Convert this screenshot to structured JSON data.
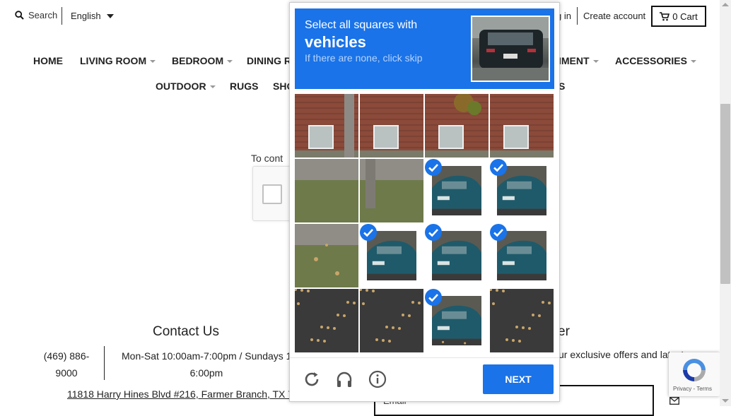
{
  "header": {
    "search_label": "Search",
    "language": "English",
    "login_partial": "g in",
    "create_account": "Create account",
    "cart_label": "0 Cart"
  },
  "nav": {
    "row1": [
      "HOME",
      "LIVING ROOM",
      "BEDROOM",
      "DINING R",
      "IMENT",
      "ACCESSORIES"
    ],
    "row2": [
      "OUTDOOR",
      "RUGS",
      "SHO",
      "S"
    ]
  },
  "page": {
    "partial_prompt": "To cont",
    "contact_title": "Contact Us",
    "phone": "(469) 886-9000",
    "hours": "Mon-Sat 10:00am-7:00pm / Sundays 1 6:00pm",
    "hours_line1": "Mon-Sat 10:00am-7:00pm / Sundays 1",
    "hours_line2": "6:00pm",
    "phone_line1": "(469) 886-",
    "phone_line2": "9000",
    "address": "11818 Harry Hines Blvd #216, Farmer Branch, TX 75",
    "newsletter_title_partial": "er",
    "offers_partial": "ur exclusive offers and latest",
    "email_placeholder": "Email",
    "recaptcha_badge": "Privacy - Terms"
  },
  "challenge": {
    "instruction": "Select all squares with",
    "target": "vehicles",
    "hint": "If there are none, click skip",
    "next_label": "NEXT",
    "tiles": [
      {
        "row": 0,
        "col": 0,
        "selected": false,
        "scene": "brick-tree"
      },
      {
        "row": 0,
        "col": 1,
        "selected": false,
        "scene": "brick"
      },
      {
        "row": 0,
        "col": 2,
        "selected": false,
        "scene": "brick-leaves"
      },
      {
        "row": 0,
        "col": 3,
        "selected": false,
        "scene": "brick"
      },
      {
        "row": 1,
        "col": 0,
        "selected": false,
        "scene": "grass"
      },
      {
        "row": 1,
        "col": 1,
        "selected": false,
        "scene": "grass-tree"
      },
      {
        "row": 1,
        "col": 2,
        "selected": true,
        "scene": "car"
      },
      {
        "row": 1,
        "col": 3,
        "selected": true,
        "scene": "car"
      },
      {
        "row": 2,
        "col": 0,
        "selected": false,
        "scene": "grass-leaves"
      },
      {
        "row": 2,
        "col": 1,
        "selected": true,
        "scene": "car"
      },
      {
        "row": 2,
        "col": 2,
        "selected": true,
        "scene": "car"
      },
      {
        "row": 2,
        "col": 3,
        "selected": true,
        "scene": "car"
      },
      {
        "row": 3,
        "col": 0,
        "selected": false,
        "scene": "road"
      },
      {
        "row": 3,
        "col": 1,
        "selected": false,
        "scene": "road"
      },
      {
        "row": 3,
        "col": 2,
        "selected": true,
        "scene": "car-road"
      },
      {
        "row": 3,
        "col": 3,
        "selected": false,
        "scene": "road"
      }
    ]
  },
  "colors": {
    "accent": "#1a73e8",
    "brick": "#8b4a3a",
    "car_teal": "#1f5a6a",
    "grass": "#6e7a4a",
    "road": "#3a3a3a"
  }
}
